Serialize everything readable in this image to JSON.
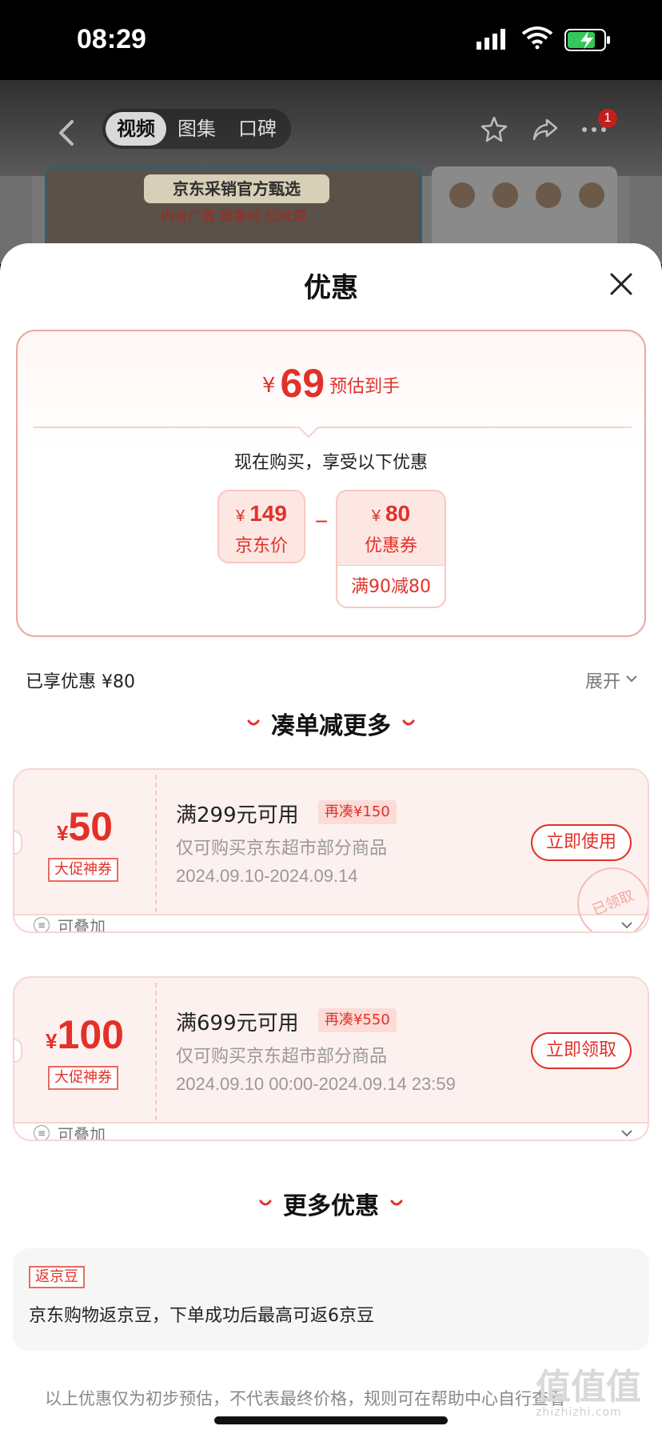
{
  "status_bar": {
    "time": "08:29"
  },
  "background": {
    "nav_tabs": [
      "视频",
      "图集",
      "口碑"
    ],
    "more_badge": "1",
    "banner_title": "京东采销官方甄选",
    "banner_subtitle": "内含广酒 稻香村 知味观"
  },
  "sheet": {
    "title": "优惠",
    "summary": {
      "currency": "¥",
      "estimated_amount": "69",
      "estimated_label": "预估到手",
      "buy_line": "现在购买，享受以下优惠",
      "jd_price": {
        "currency": "¥",
        "amount": "149",
        "label": "京东价"
      },
      "minus": "−",
      "coupon": {
        "currency": "¥",
        "amount": "80",
        "label": "优惠券",
        "condition": "满90减80"
      }
    },
    "enjoyed_label": "已享优惠 ¥80",
    "expand_label": "展开",
    "section_more_reduce": "凑单减更多",
    "coupons": [
      {
        "currency": "¥",
        "amount": "50",
        "tag": "大促神券",
        "condition": "满299元可用",
        "chip": "再凑¥150",
        "desc": "仅可购买京东超市部分商品",
        "date": "2024.09.10-2024.09.14",
        "button": "立即使用",
        "stamp": "已领取",
        "stack_label": "可叠加"
      },
      {
        "currency": "¥",
        "amount": "100",
        "tag": "大促神券",
        "condition": "满699元可用",
        "chip": "再凑¥550",
        "desc": "仅可购买京东超市部分商品",
        "date": "2024.09.10 00:00-2024.09.14 23:59",
        "button": "立即领取",
        "stack_label": "可叠加"
      }
    ],
    "section_more_offers": "更多优惠",
    "bean": {
      "tag": "返京豆",
      "text": "京东购物返京豆，下单成功后最高可返6京豆"
    },
    "disclaimer": "以上优惠仅为初步预估，不代表最终价格，规则可在帮助中心自行查看"
  },
  "watermark": {
    "main": "值值值",
    "sub": "zhizhizhi.com"
  },
  "colors": {
    "accent": "#e2312a",
    "coupon_bg": "#fdf1ef",
    "border": "#eaa9a2"
  }
}
